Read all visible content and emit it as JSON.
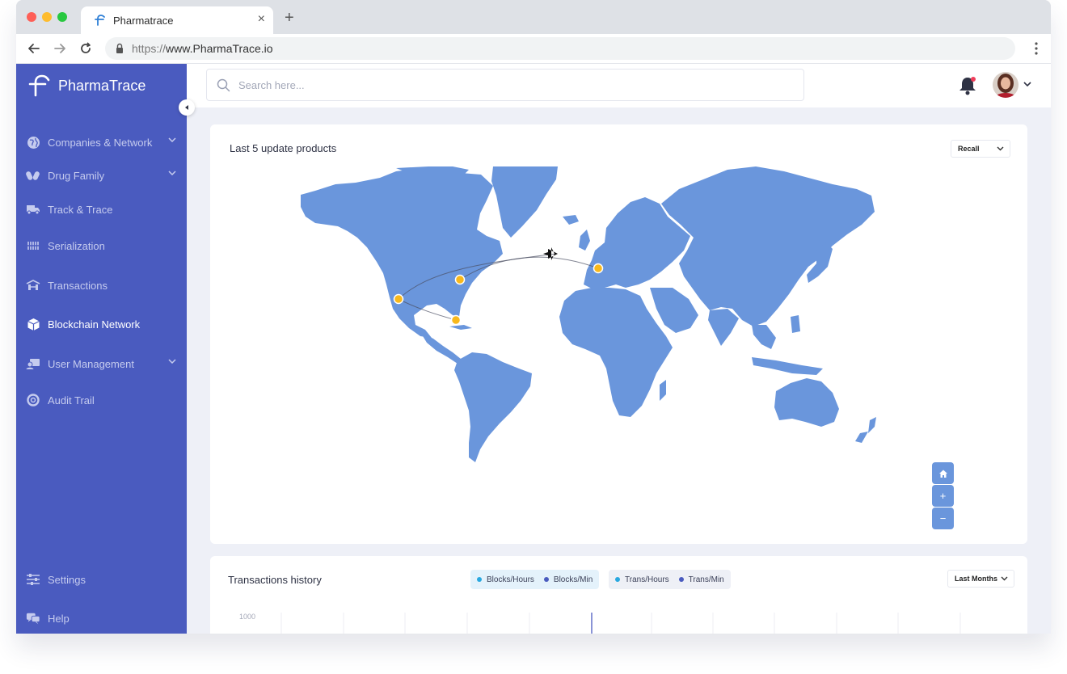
{
  "browser": {
    "tab_title": "Pharmatrace",
    "tab_close": "×",
    "new_tab": "+",
    "url_scheme": "https://",
    "url_host": "www.PharmaTrace.io",
    "traffic_lights": [
      "#fe5f57",
      "#febc2e",
      "#28c840"
    ]
  },
  "app": {
    "brand": "PharmaTrace",
    "accent": "#4a5bbf",
    "map_color": "#6a96dc",
    "marker_color": "#f8b81c"
  },
  "sidebar": {
    "items": [
      {
        "label": "Companies & Network",
        "icon": "globe-icon",
        "has_chevron": true
      },
      {
        "label": "Drug Family",
        "icon": "pills-icon",
        "has_chevron": true
      },
      {
        "label": "Track & Trace",
        "icon": "truck-icon",
        "has_chevron": false
      },
      {
        "label": "Serialization",
        "icon": "serialization-icon",
        "has_chevron": false
      },
      {
        "label": "Transactions",
        "icon": "transactions-icon",
        "has_chevron": false
      },
      {
        "label": "Blockchain Network",
        "icon": "cube-icon",
        "has_chevron": false,
        "active": true
      },
      {
        "label": "User Management",
        "icon": "user-card-icon",
        "has_chevron": true
      },
      {
        "label": "Audit Trail",
        "icon": "lifebuoy-icon",
        "has_chevron": false
      }
    ],
    "footer": [
      {
        "label": "Settings",
        "icon": "sliders-icon"
      },
      {
        "label": "Help",
        "icon": "chat-help-icon"
      }
    ]
  },
  "header": {
    "search_placeholder": "Search here..."
  },
  "map_card": {
    "title": "Last 5 update products",
    "filter": "Recall",
    "controls": {
      "home": "home-icon",
      "zoom_in": "+",
      "zoom_out": "−"
    }
  },
  "transactions_card": {
    "title": "Transactions history",
    "legend_a": [
      {
        "label": "Blocks/Hours",
        "color": "#29a8e0"
      },
      {
        "label": "Blocks/Min",
        "color": "#4a5bbf"
      }
    ],
    "legend_b": [
      {
        "label": "Trans/Hours",
        "color": "#29a8e0"
      },
      {
        "label": "Trans/Min",
        "color": "#4a5bbf"
      }
    ],
    "period": "Last Months",
    "y_tick": "1000"
  }
}
